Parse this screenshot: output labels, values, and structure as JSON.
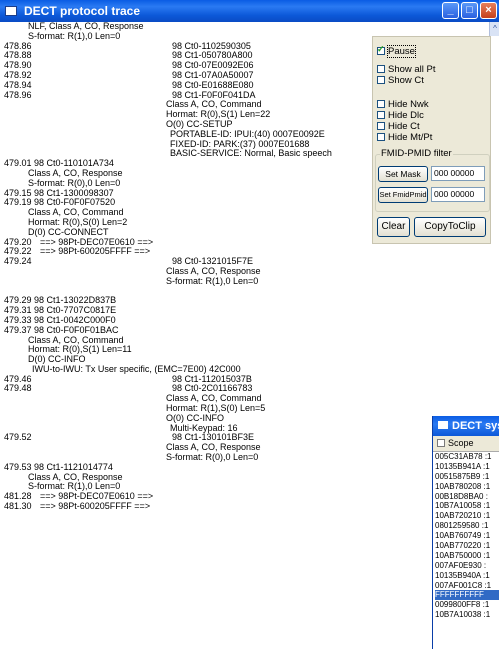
{
  "window": {
    "title": "DECT protocol trace",
    "controls": {
      "minimize": "_",
      "maximize": "□",
      "close": "×"
    }
  },
  "trace_lines": [
    {
      "indent": 4,
      "text": "NLF, Class A, CO, Response"
    },
    {
      "indent": 4,
      "text": "S-format: R(1),0 Len=0"
    },
    {
      "time": "478.86",
      "text": "98 Ct0-1102590305",
      "col": 2
    },
    {
      "time": "478.88",
      "text": "98 Ct1-050780A800",
      "col": 2
    },
    {
      "time": "478.90",
      "text": "98 Ct0-07E0092E06",
      "col": 2
    },
    {
      "time": "478.92",
      "text": "98 Ct1-07A0A50007",
      "col": 2
    },
    {
      "time": "478.94",
      "text": "98 Ct0-E01688E080",
      "col": 2
    },
    {
      "time": "478.96",
      "text": "98 Ct1-F0F0F041DA",
      "col": 2
    },
    {
      "indent": 2,
      "text": "Class A, CO, Command"
    },
    {
      "indent": 2,
      "text": "Hormat: R(0),S(1) Len=22"
    },
    {
      "indent": 2,
      "text": "O(0) CC-SETUP"
    },
    {
      "indent": 3,
      "text": "PORTABLE-ID: IPUI:(40) 0007E0092E"
    },
    {
      "indent": 3,
      "text": "FIXED-ID: PARK:(37) 0007E01688"
    },
    {
      "indent": 3,
      "text": "BASIC-SERVICE: Normal, Basic speech"
    },
    {
      "text": "479.01 98 Ct0-110101A734"
    },
    {
      "indent": 4,
      "text": "Class A, CO, Response"
    },
    {
      "indent": 4,
      "text": "S-format: R(0),0 Len=0"
    },
    {
      "text": "479.15 98 Ct1-1300098307"
    },
    {
      "text": "479.19 98 Ct0-F0F0F07520"
    },
    {
      "indent": 4,
      "text": "Class A, CO, Command"
    },
    {
      "indent": 4,
      "text": "Hormat: R(0),S(0) Len=2"
    },
    {
      "indent": 4,
      "text": "D(0) CC-CONNECT"
    },
    {
      "time": "479.20",
      "text": "==> 98Pt-DEC07E0610 ==>",
      "col": 1
    },
    {
      "time": "479.22",
      "text": "==> 98Pt-600205FFFF ==>",
      "col": 1
    },
    {
      "time": "479.24",
      "text": "98 Ct0-1321015F7E",
      "col": 2
    },
    {
      "indent": 2,
      "text": "Class A, CO, Response"
    },
    {
      "indent": 2,
      "text": "S-format: R(1),0 Len=0"
    },
    {
      "text": ""
    },
    {
      "text": "479.29 98 Ct1-13022D837B"
    },
    {
      "text": "479.31 98 Ct0-7707C0817E"
    },
    {
      "text": "479.33 98 Ct1-0042C000F0"
    },
    {
      "text": "479.37 98 Ct0-F0F0F01BAC"
    },
    {
      "indent": 4,
      "text": "Class A, CO, Command"
    },
    {
      "indent": 4,
      "text": "Hormat: R(0),S(1) Len=11"
    },
    {
      "indent": 4,
      "text": "D(0) CC-INFO"
    },
    {
      "indent": 5,
      "text": "IWU-to-IWU: Tx User specific, (EMC=7E00) 42C000"
    },
    {
      "time": "479.46",
      "text": "98 Ct1-112015037B",
      "col": 2
    },
    {
      "time": "479.48",
      "text": "98 Ct0-2C01166783",
      "col": 2
    },
    {
      "indent": 2,
      "text": "Class A, CO, Command"
    },
    {
      "indent": 2,
      "text": "Hormat: R(1),S(0) Len=5"
    },
    {
      "indent": 2,
      "text": "O(0) CC-INFO"
    },
    {
      "indent": 3,
      "text": "Multi-Keypad: 16"
    },
    {
      "time": "479.52",
      "text": "98 Ct1-130101BF3E",
      "col": 2
    },
    {
      "indent": 2,
      "text": "Class A, CO, Response"
    },
    {
      "indent": 2,
      "text": "S-format: R(0),0 Len=0"
    },
    {
      "text": "479.53 98 Ct1-1121014774"
    },
    {
      "indent": 4,
      "text": "Class A, CO, Response"
    },
    {
      "indent": 4,
      "text": "S-format: R(1),0 Len=0"
    },
    {
      "time": "481.28",
      "text": "==> 98Pt-DEC07E0610 ==>",
      "col": 1
    },
    {
      "time": "481.30",
      "text": "==> 98Pt-600205FFFF ==>",
      "col": 1
    }
  ],
  "options": {
    "pause": {
      "label": "Pause",
      "checked": true
    },
    "show_all_pt": {
      "label": "Show all Pt",
      "checked": false
    },
    "show_ct": {
      "label": "Show Ct",
      "checked": false
    },
    "hide_nwk": {
      "label": "Hide Nwk",
      "checked": false
    },
    "hide_dlc": {
      "label": "Hide Dlc",
      "checked": false
    },
    "hide_ct": {
      "label": "Hide Ct",
      "checked": false
    },
    "hide_mtpt": {
      "label": "Hide Mt/Pt",
      "checked": false
    }
  },
  "filter": {
    "group_label": "FMID-PMID filter",
    "set_mask_label": "Set Mask",
    "mask_value": "000 00000",
    "set_fmidpmid_label": "Set FmidPmid",
    "fmidpmid_value": "000 00000"
  },
  "buttons": {
    "clear": "Clear",
    "copy": "CopyToClip"
  },
  "system_window": {
    "title": "DECT system",
    "scope_label": "Scope",
    "items": [
      "005C31AB78 :1",
      "10135B941A :1",
      "00515875B9 :1",
      "10AB780208 :1",
      "00B18D8BA0 :",
      "10B7A10058 :1",
      "10AB720210 :1",
      "0801259580 :1",
      "10AB760749 :1",
      "10AB770220 :1",
      "10AB750000 :1",
      "007AF0E930 :",
      "10135B940A :1",
      "007AF001C8 :1",
      "FFFFFFFFFF",
      "0099800FF8 :1",
      "10B7A10038 :1"
    ],
    "selected_index": 14
  }
}
